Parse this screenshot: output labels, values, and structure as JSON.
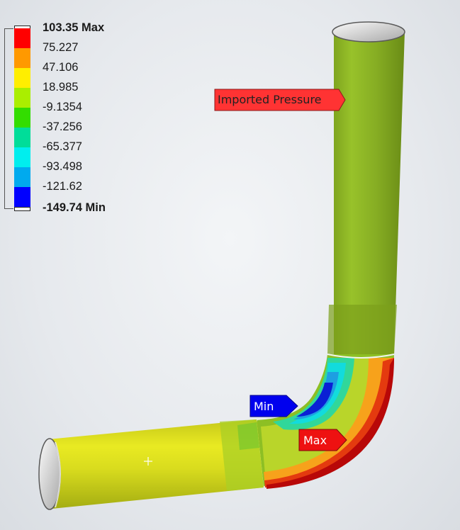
{
  "legend": {
    "items": [
      {
        "label": "103.35 Max",
        "color": "#ff0000",
        "bold": true
      },
      {
        "label": "75.227",
        "color": "#ff9900",
        "bold": false
      },
      {
        "label": "47.106",
        "color": "#ffee00",
        "bold": false
      },
      {
        "label": "18.985",
        "color": "#aaee00",
        "bold": false
      },
      {
        "label": "-9.1354",
        "color": "#33dd00",
        "bold": false
      },
      {
        "label": "-37.256",
        "color": "#00dd99",
        "bold": false
      },
      {
        "label": "-65.377",
        "color": "#00eeee",
        "bold": false
      },
      {
        "label": "-93.498",
        "color": "#00aaee",
        "bold": false
      },
      {
        "label": "-121.62",
        "color": "#0000ff",
        "bold": false
      },
      {
        "label": "-149.74 Min",
        "color": "",
        "bold": true
      }
    ]
  },
  "annotations": {
    "imported_label": "Imported Pressure",
    "imported_color": "#ff3333",
    "min_label": "Min",
    "min_color": "#0000ee",
    "max_label": "Max",
    "max_color": "#ee1111"
  }
}
